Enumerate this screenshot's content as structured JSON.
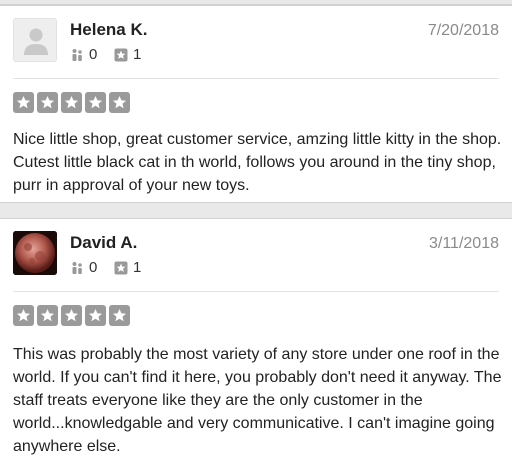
{
  "reviews": [
    {
      "name": "Helena K.",
      "date": "7/20/2018",
      "friends": "0",
      "reviews": "1",
      "rating": 5,
      "avatar": "default-user-icon",
      "text": "Nice little shop, great customer service, amzing little kitty in the shop. Cutest little black cat in th world, follows you around in the tiny shop, purr in approval of your new toys."
    },
    {
      "name": "David A.",
      "date": "3/11/2018",
      "friends": "0",
      "reviews": "1",
      "rating": 5,
      "avatar": "moon-photo",
      "text": "This was probably the most variety of any store under one roof in the world. If you can't find it here, you probably don't need it anyway. The staff treats everyone like they are the only customer in the world...knowledgable and very communicative. I can't imagine going anywhere else."
    }
  ],
  "colors": {
    "star_box": "#9a9a9a",
    "date": "#8a8a8a",
    "background": "#e9e9e9"
  }
}
